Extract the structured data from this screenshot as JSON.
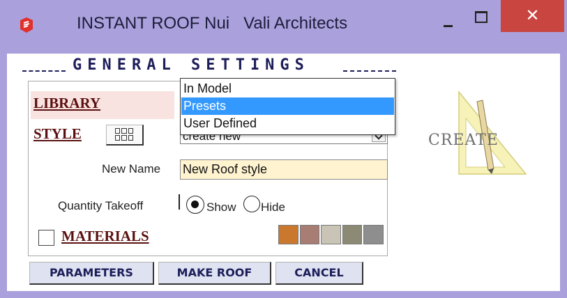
{
  "window": {
    "title": "INSTANT ROOF Nui   Vali Architects",
    "app_icon": "sketchup-icon",
    "controls": {
      "minimize": "minimize-icon",
      "maximize": "maximize-icon",
      "close": "✕"
    }
  },
  "header": {
    "title": "GENERAL SETTINGS"
  },
  "library": {
    "label": "LIBRARY",
    "dropdown_options": [
      "In Model",
      "Presets",
      "User Defined"
    ],
    "highlighted_option": "Presets"
  },
  "style": {
    "label": "STYLE",
    "select_value": "create new",
    "grid_icon": "grid-icon"
  },
  "new_name": {
    "label": "New Name",
    "value": "New Roof style"
  },
  "quantity_takeoff": {
    "label": "Quantity Takeoff",
    "show_label": "Show",
    "hide_label": "Hide",
    "selected": "Show"
  },
  "materials": {
    "label": "MATERIALS",
    "checked": false,
    "swatch_colors": [
      "#c9782d",
      "#a87d74",
      "#c9c4b6",
      "#8c8a74",
      "#8e8e8e"
    ]
  },
  "logo": {
    "text": "CREATE"
  },
  "buttons": {
    "parameters": "PARAMETERS",
    "make_roof": "MAKE ROOF",
    "cancel": "CANCEL"
  },
  "colors": {
    "title_bar": "#aaa1dc",
    "close_button": "#c9453f",
    "label_text": "#5a1010",
    "heading_text": "#1d1d5a",
    "selection_highlight": "#3399ff",
    "input_background": "#fff3d0",
    "button_background": "#dfe3f1"
  }
}
